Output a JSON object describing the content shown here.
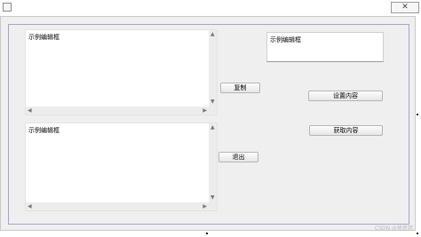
{
  "window": {
    "close_glyph": "✕"
  },
  "edits": {
    "top_left": "示例编辑框",
    "bottom_left": "示例编辑框",
    "top_right": "示例编辑框"
  },
  "buttons": {
    "copy": "复制",
    "exit": "退出",
    "set_content": "设置内容",
    "get_content": "获取内容"
  },
  "scroll_arrows": {
    "up": "▲",
    "down": "▼",
    "left": "◀",
    "right": "▶"
  },
  "watermark": "CSDN @徐思邦"
}
